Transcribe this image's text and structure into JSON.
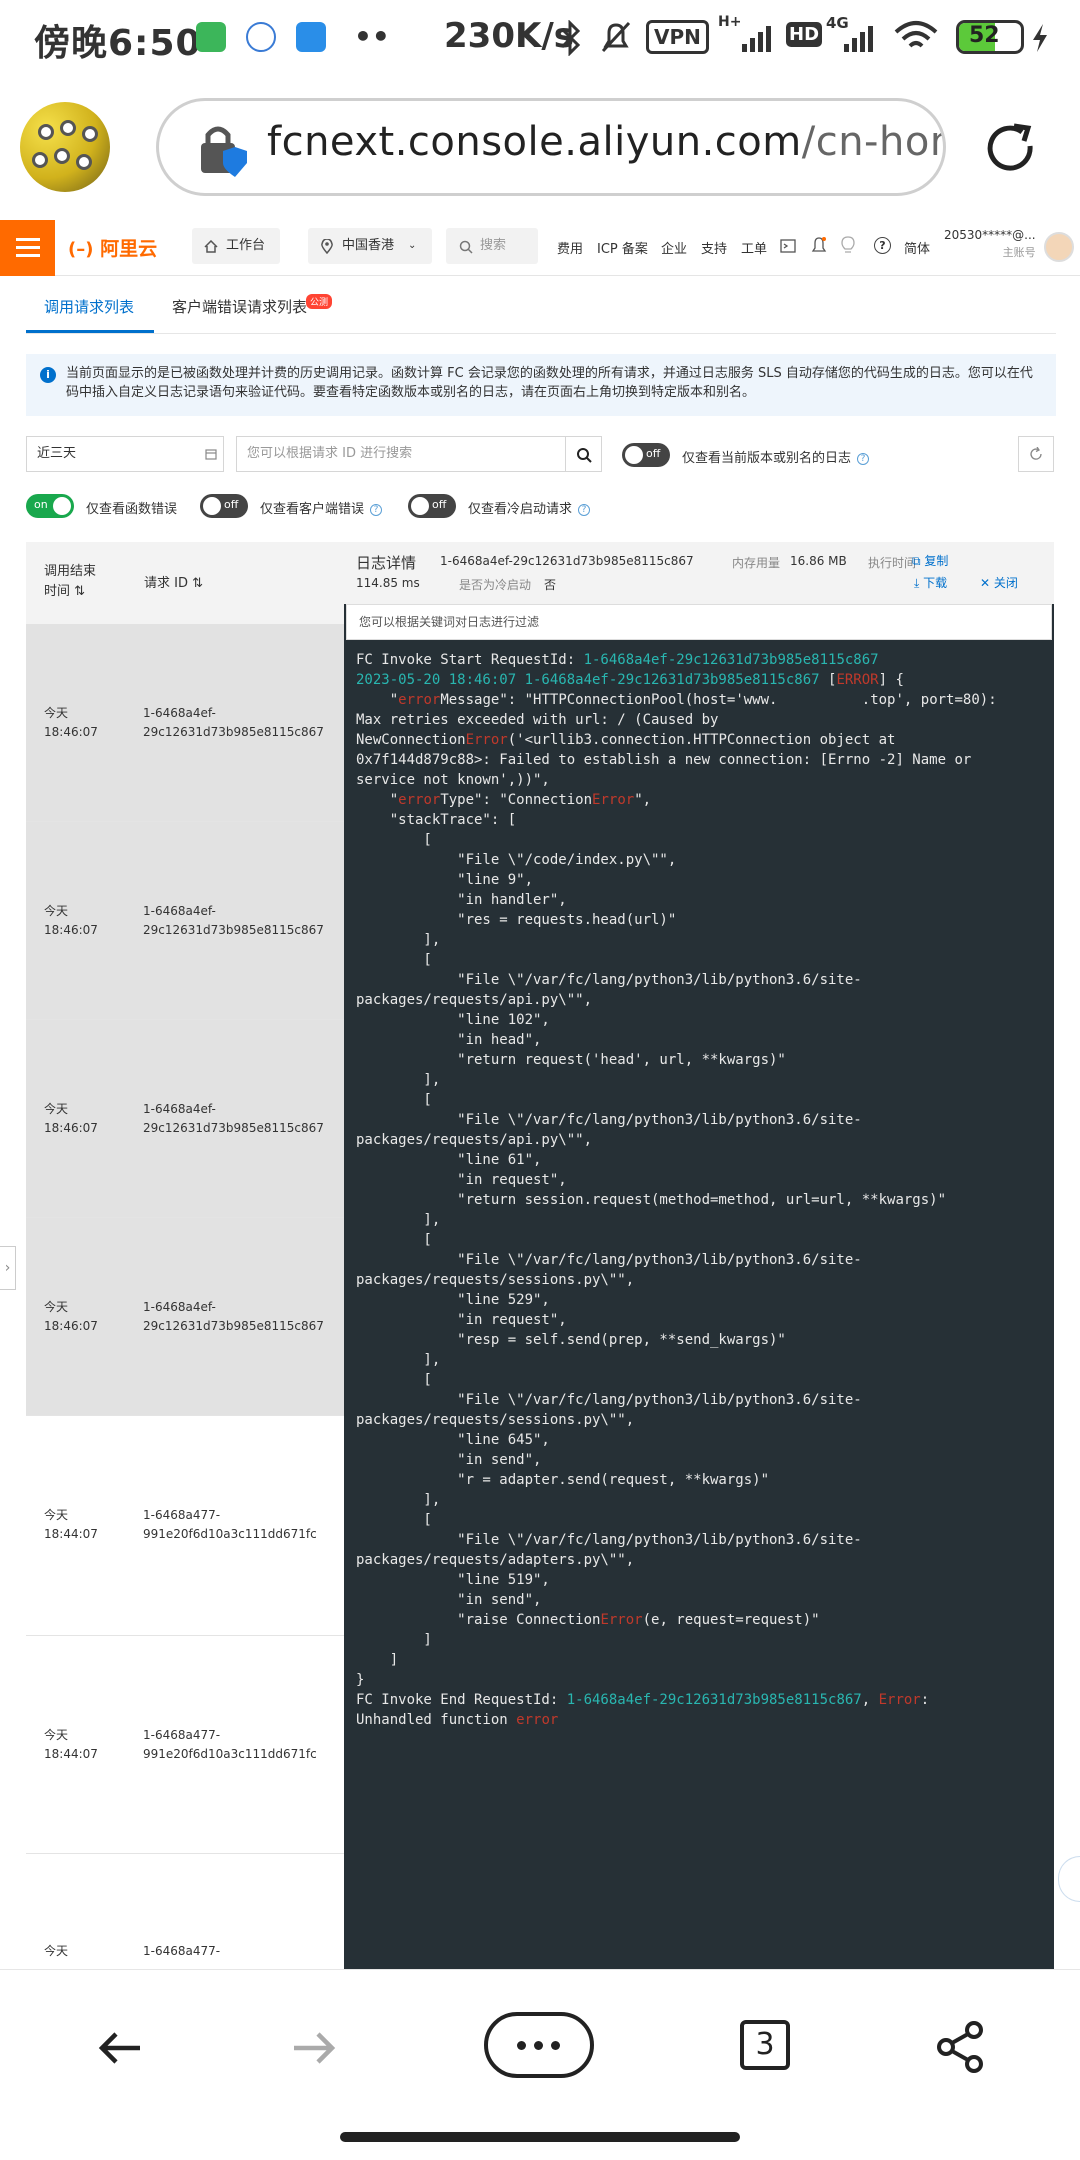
{
  "status_bar": {
    "time": "傍晚6:50",
    "network_speed": "230K/s",
    "vpn": "VPN",
    "hd": "HD",
    "h_plus": "H+",
    "signal_4g": "4G",
    "battery": "52",
    "app_icons": [
      "green-app-icon",
      "blue-bird-icon",
      "blue-flag-icon"
    ],
    "more_dots": "••"
  },
  "browser": {
    "url_host": "fcnext.console.aliyun.com",
    "url_rest": "/cn-hong",
    "tab_count": "3"
  },
  "console_header": {
    "logo": "阿里云",
    "workbench": "工作台",
    "region": "中国香港",
    "search_placeholder": "搜索",
    "links": [
      "费用",
      "ICP 备案",
      "企业",
      "支持",
      "工单"
    ],
    "language": "简体",
    "account": "20530*****@...",
    "account_role": "主账号"
  },
  "tabs": {
    "active": "调用请求列表",
    "second": "客户端错误请求列表",
    "badge": "公测"
  },
  "notice": "当前页面显示的是已被函数处理并计费的历史调用记录。函数计算 FC 会记录您的函数处理的所有请求，并通过日志服务 SLS 自动存储您的代码生成的日志。您可以在代码中插入自定义日志记录语句来验证代码。要查看特定函数版本或别名的日志，请在页面右上角切换到特定版本和别名。",
  "filters": {
    "time_range": "近三天",
    "request_id_placeholder": "您可以根据请求 ID 进行搜索",
    "version_toggle": "off",
    "version_label": "仅查看当前版本或别名的日志",
    "func_error_toggle": "on",
    "func_error_label": "仅查看函数错误",
    "client_error_toggle": "off",
    "client_error_label": "仅查看客户端错误",
    "cold_start_toggle": "off",
    "cold_start_label": "仅查看冷启动请求"
  },
  "list": {
    "col_time": "调用结束时间",
    "col_id": "请求 ID",
    "rows": [
      {
        "day": "今天",
        "time": "18:46:07",
        "id1": "1-6468a4ef-",
        "id2": "29c12631d73b985e8115c867"
      },
      {
        "day": "今天",
        "time": "18:46:07",
        "id1": "1-6468a4ef-",
        "id2": "29c12631d73b985e8115c867"
      },
      {
        "day": "今天",
        "time": "18:46:07",
        "id1": "1-6468a4ef-",
        "id2": "29c12631d73b985e8115c867"
      },
      {
        "day": "今天",
        "time": "18:46:07",
        "id1": "1-6468a4ef-",
        "id2": "29c12631d73b985e8115c867"
      },
      {
        "day": "今天",
        "time": "18:44:07",
        "id1": "1-6468a477-",
        "id2": "991e20f6d10a3c111dd671fc"
      },
      {
        "day": "今天",
        "time": "18:44:07",
        "id1": "1-6468a477-",
        "id2": "991e20f6d10a3c111dd671fc"
      },
      {
        "day": "今天",
        "time": "",
        "id1": "1-6468a477-",
        "id2": ""
      }
    ]
  },
  "detail": {
    "title": "日志详情",
    "request_id": "1-6468a4ef-29c12631d73b985e8115c867",
    "memory_label": "内存用量",
    "memory_value": "16.86 MB",
    "exec_label": "执行时间",
    "exec_value": "114.85 ms",
    "cold_label": "是否为冷启动",
    "cold_value": "否",
    "copy": "复制",
    "download": "下载",
    "close": "关闭",
    "filter_placeholder": "您可以根据关键词对日志进行过滤"
  },
  "log": {
    "l1a": "FC Invoke Start RequestId: ",
    "l1b": "1-6468a4ef-29c12631d73b985e8115c867",
    "l2a": "2023-05-20 18:46:07 1-6468a4ef-29c12631d73b985e8115c867",
    "l2b": " [",
    "l2c": "ERROR",
    "l2d": "] {",
    "l3a": "    \"",
    "l3b": "error",
    "l3c": "Message\": \"HTTPConnectionPool(host='www.",
    "l3d": "          ",
    "l3e": ".top', port=80):",
    "l4": "Max retries exceeded with url: / (Caused by",
    "l5a": "NewConnection",
    "l5b": "Error",
    "l5c": "('<urllib3.connection.HTTPConnection object at",
    "l6": "0x7f144d879c88>: Failed to establish a new connection: [Errno -2] Name or",
    "l7": "service not known',))\",",
    "l8a": "    \"",
    "l8b": "error",
    "l8c": "Type\": \"Connection",
    "l8d": "Error",
    "l8e": "\",",
    "body": "    \"stackTrace\": [\n        [\n            \"File \\\"/code/index.py\\\"\",\n            \"line 9\",\n            \"in handler\",\n            \"res = requests.head(url)\"\n        ],\n        [\n            \"File \\\"/var/fc/lang/python3/lib/python3.6/site-\npackages/requests/api.py\\\"\",\n            \"line 102\",\n            \"in head\",\n            \"return request('head', url, **kwargs)\"\n        ],\n        [\n            \"File \\\"/var/fc/lang/python3/lib/python3.6/site-\npackages/requests/api.py\\\"\",\n            \"line 61\",\n            \"in request\",\n            \"return session.request(method=method, url=url, **kwargs)\"\n        ],\n        [\n            \"File \\\"/var/fc/lang/python3/lib/python3.6/site-\npackages/requests/sessions.py\\\"\",\n            \"line 529\",\n            \"in request\",\n            \"resp = self.send(prep, **send_kwargs)\"\n        ],\n        [\n            \"File \\\"/var/fc/lang/python3/lib/python3.6/site-\npackages/requests/sessions.py\\\"\",\n            \"line 645\",\n            \"in send\",\n            \"r = adapter.send(request, **kwargs)\"\n        ],\n        [\n            \"File \\\"/var/fc/lang/python3/lib/python3.6/site-\npackages/requests/adapters.py\\\"\",\n            \"line 519\",\n            \"in send\",",
    "l_raise_a": "            \"raise Connection",
    "l_raise_b": "Error",
    "l_raise_c": "(e, request=request)\"",
    "close_block": "        ]\n    ]\n}",
    "end_a": "FC Invoke End RequestId: ",
    "end_b": "1-6468a4ef-29c12631d73b985e8115c867",
    "end_c": ", ",
    "end_d": "Error",
    "end_e": ":",
    "end2a": "Unhandled function ",
    "end2b": "error"
  },
  "colors": {
    "accent": "#ff6a00",
    "link": "#0070cc",
    "log_bg": "#263036",
    "log_cyan": "#29b6b0",
    "log_red": "#c0392b",
    "toggle_on": "#19a84d"
  }
}
